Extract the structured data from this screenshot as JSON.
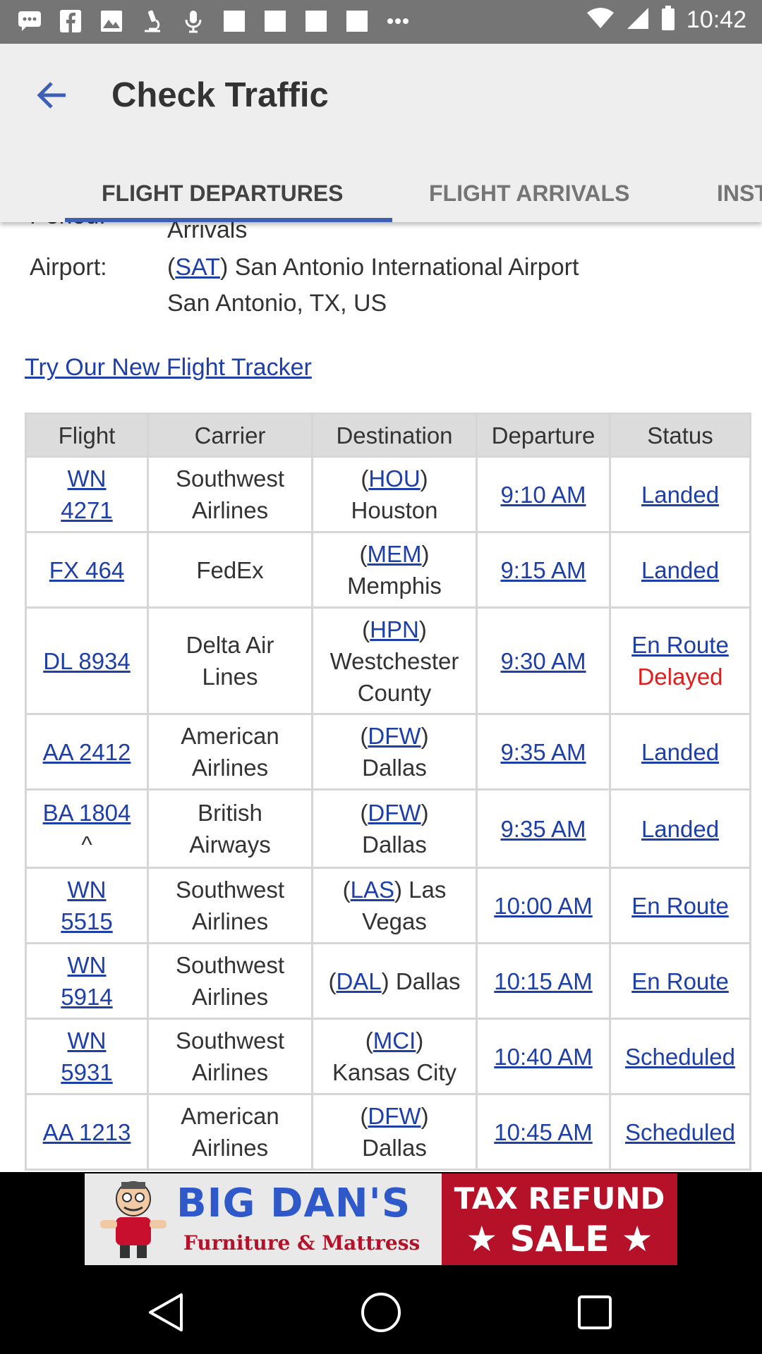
{
  "status_bar": {
    "time": "10:42",
    "left_icons": [
      "message-icon",
      "facebook-icon",
      "image-icon",
      "microscope-icon",
      "microphone-icon",
      "square-icon",
      "square-icon",
      "square-icon",
      "square-icon",
      "more-dots-icon"
    ],
    "right_icons": [
      "wifi-icon",
      "signal-icon",
      "battery-icon"
    ]
  },
  "app_bar": {
    "title": "Check Traffic",
    "back_icon": "arrow-back-icon",
    "tabs": [
      {
        "label": "FLIGHT DEPARTURES",
        "active": true
      },
      {
        "label": "FLIGHT ARRIVALS",
        "active": false
      },
      {
        "label": "INST",
        "active": false
      }
    ]
  },
  "info": {
    "period_label": "Period:",
    "period_value": "Arrivals",
    "airport_label": "Airport:",
    "airport_code": "SAT",
    "airport_name": "San Antonio International Airport",
    "airport_city": "San Antonio, TX, US",
    "tracker_link": "Try Our New Flight Tracker"
  },
  "table": {
    "headers": [
      "Flight",
      "Carrier",
      "Destination",
      "Departure",
      "Status"
    ],
    "rows": [
      {
        "flight": [
          "WN",
          "4271"
        ],
        "carrier": [
          "Southwest",
          "Airlines"
        ],
        "dest_code": "HOU",
        "dest_city": [
          "Houston"
        ],
        "departure": "9:10 AM",
        "status": "Landed",
        "status_note": ""
      },
      {
        "flight": [
          "FX 464"
        ],
        "carrier": [
          "FedEx"
        ],
        "dest_code": "MEM",
        "dest_city": [
          "Memphis"
        ],
        "departure": "9:15 AM",
        "status": "Landed",
        "status_note": ""
      },
      {
        "flight": [
          "DL 8934"
        ],
        "carrier": [
          "Delta Air",
          "Lines"
        ],
        "dest_code": "HPN",
        "dest_city": [
          "Westchester",
          "County"
        ],
        "departure": "9:30 AM",
        "status": "En Route",
        "status_note": "Delayed"
      },
      {
        "flight": [
          "AA 2412"
        ],
        "carrier": [
          "American",
          "Airlines"
        ],
        "dest_code": "DFW",
        "dest_city": [
          "Dallas"
        ],
        "departure": "9:35 AM",
        "status": "Landed",
        "status_note": ""
      },
      {
        "flight": [
          "BA 1804"
        ],
        "flight_note": "^",
        "carrier": [
          "British",
          "Airways"
        ],
        "dest_code": "DFW",
        "dest_city": [
          "Dallas"
        ],
        "departure": "9:35 AM",
        "status": "Landed",
        "status_note": ""
      },
      {
        "flight": [
          "WN",
          "5515"
        ],
        "carrier": [
          "Southwest",
          "Airlines"
        ],
        "dest_code": "LAS",
        "dest_city_inline": "Las",
        "dest_city": [
          "Vegas"
        ],
        "departure": "10:00 AM",
        "status": "En Route",
        "status_note": ""
      },
      {
        "flight": [
          "WN",
          "5914"
        ],
        "carrier": [
          "Southwest",
          "Airlines"
        ],
        "dest_code": "DAL",
        "dest_city_inline": "Dallas",
        "dest_city": [],
        "departure": "10:15 AM",
        "status": "En Route",
        "status_note": ""
      },
      {
        "flight": [
          "WN",
          "5931"
        ],
        "carrier": [
          "Southwest",
          "Airlines"
        ],
        "dest_code": "MCI",
        "dest_city": [
          "Kansas City"
        ],
        "departure": "10:40 AM",
        "status": "Scheduled",
        "status_note": ""
      },
      {
        "flight": [
          "AA 1213"
        ],
        "carrier": [
          "American",
          "Airlines"
        ],
        "dest_code": "DFW",
        "dest_city": [
          "Dallas"
        ],
        "departure": "10:45 AM",
        "status": "Scheduled",
        "status_note": ""
      }
    ]
  },
  "ad": {
    "brand": "BIG DAN'S",
    "subtitle": "Furniture & Mattress",
    "sale_line1": "TAX REFUND",
    "sale_line2": "★ SALE ★"
  },
  "colors": {
    "link": "#1e3fa8",
    "delayed": "#e31b1b",
    "tab_indicator": "#3f5fb5",
    "ad_red": "#b5122a",
    "ad_blue": "#2f58c8"
  },
  "nav_bar": {
    "icons": [
      "back-triangle-icon",
      "home-circle-icon",
      "recents-square-icon"
    ]
  }
}
